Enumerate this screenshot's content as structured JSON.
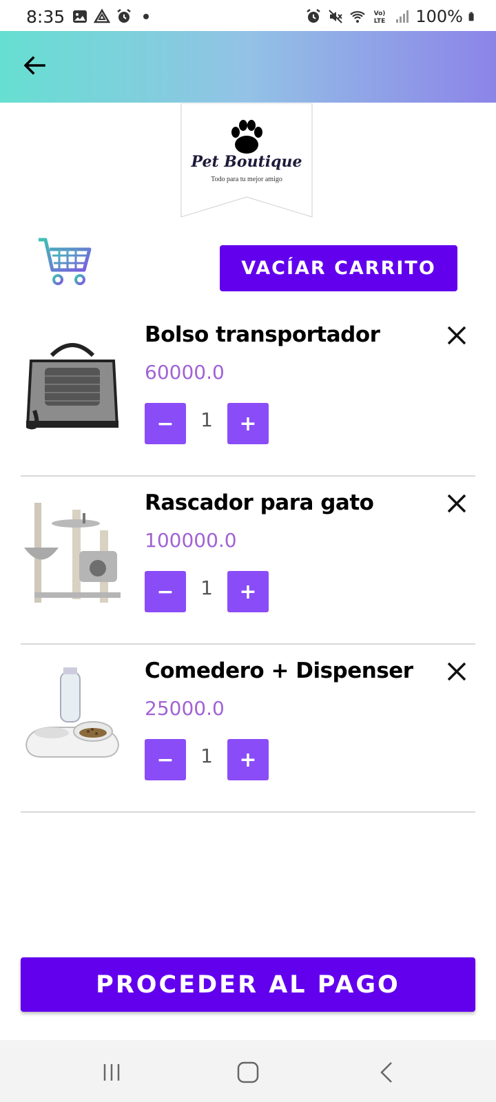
{
  "status_bar": {
    "time": "8:35",
    "battery_percent": "100%",
    "left_icons": [
      "gallery-icon",
      "drive-icon",
      "alarm-icon",
      "dot-icon"
    ],
    "right_icons": [
      "alarm-icon",
      "mute-icon",
      "wifi-icon",
      "volte-icon",
      "signal-icon",
      "battery-icon"
    ]
  },
  "app_bar": {
    "back_icon": "arrow-left-icon",
    "gradient": [
      "#66dfd1",
      "#8c84e8"
    ]
  },
  "logo": {
    "brand": "Pet Boutique",
    "tagline": "Todo para tu mejor amigo"
  },
  "cart": {
    "cart_icon": "shopping-cart-icon",
    "empty_label": "VACÍAR CARRITO",
    "items": [
      {
        "name": "Bolso transportador",
        "price": "60000.0",
        "quantity": "1",
        "image": "pet-carrier-bag"
      },
      {
        "name": "Rascador para gato",
        "price": "100000.0",
        "quantity": "1",
        "image": "cat-scratcher-tree"
      },
      {
        "name": "Comedero + Dispenser",
        "price": "25000.0",
        "quantity": "1",
        "image": "feeder-water-dispenser"
      }
    ],
    "minus_label": "−",
    "plus_label": "+"
  },
  "checkout": {
    "label": "PROCEDER AL PAGO"
  },
  "colors": {
    "primary": "#6200ee",
    "qty_button": "#8a4cf7",
    "price": "#a163d4"
  },
  "nav_bar": {
    "icons": [
      "recent-apps-icon",
      "home-icon",
      "back-icon"
    ]
  }
}
